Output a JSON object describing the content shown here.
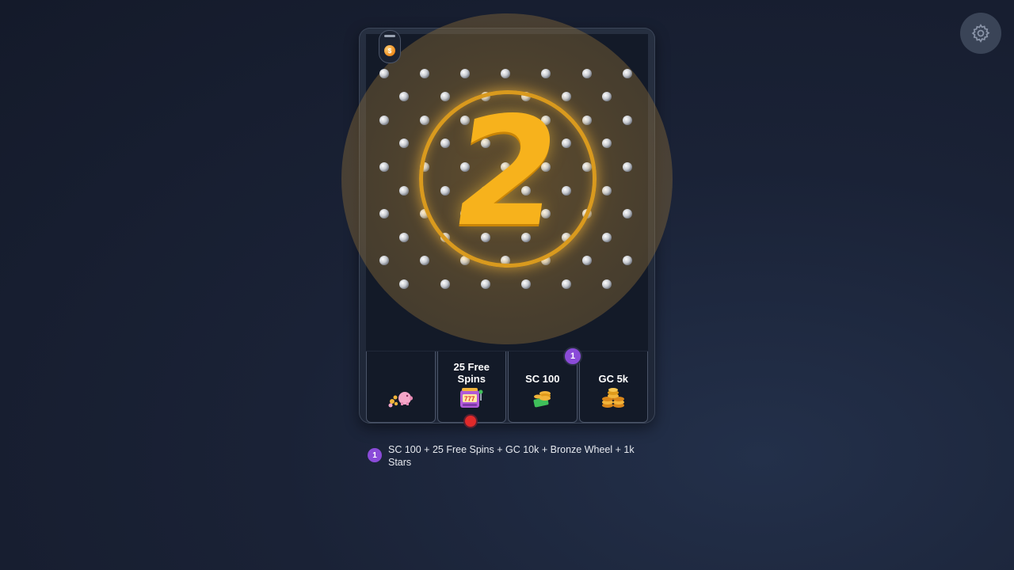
{
  "settings": {
    "icon": "gear-icon"
  },
  "board": {
    "dropper": {
      "ball_label": "$"
    },
    "multiplier_number": "2"
  },
  "slots": [
    {
      "label": "",
      "icon": "piggy-bank-coins-icon"
    },
    {
      "label": "25 Free Spins",
      "icon": "slot-machine-777-icon"
    },
    {
      "label": "SC 100",
      "icon": "cash-coins-icon"
    },
    {
      "label": "GC 5k",
      "icon": "gold-coin-stack-icon"
    }
  ],
  "slot_badge": "1",
  "legend": {
    "badge": "1",
    "text": "SC 100 + 25 Free Spins + GC 10k + Bronze Wheel + 1k Stars"
  },
  "colors": {
    "accent_gold": "#f7b21c",
    "badge_purple": "#8a4bd8",
    "marker_red": "#e02a2a"
  }
}
